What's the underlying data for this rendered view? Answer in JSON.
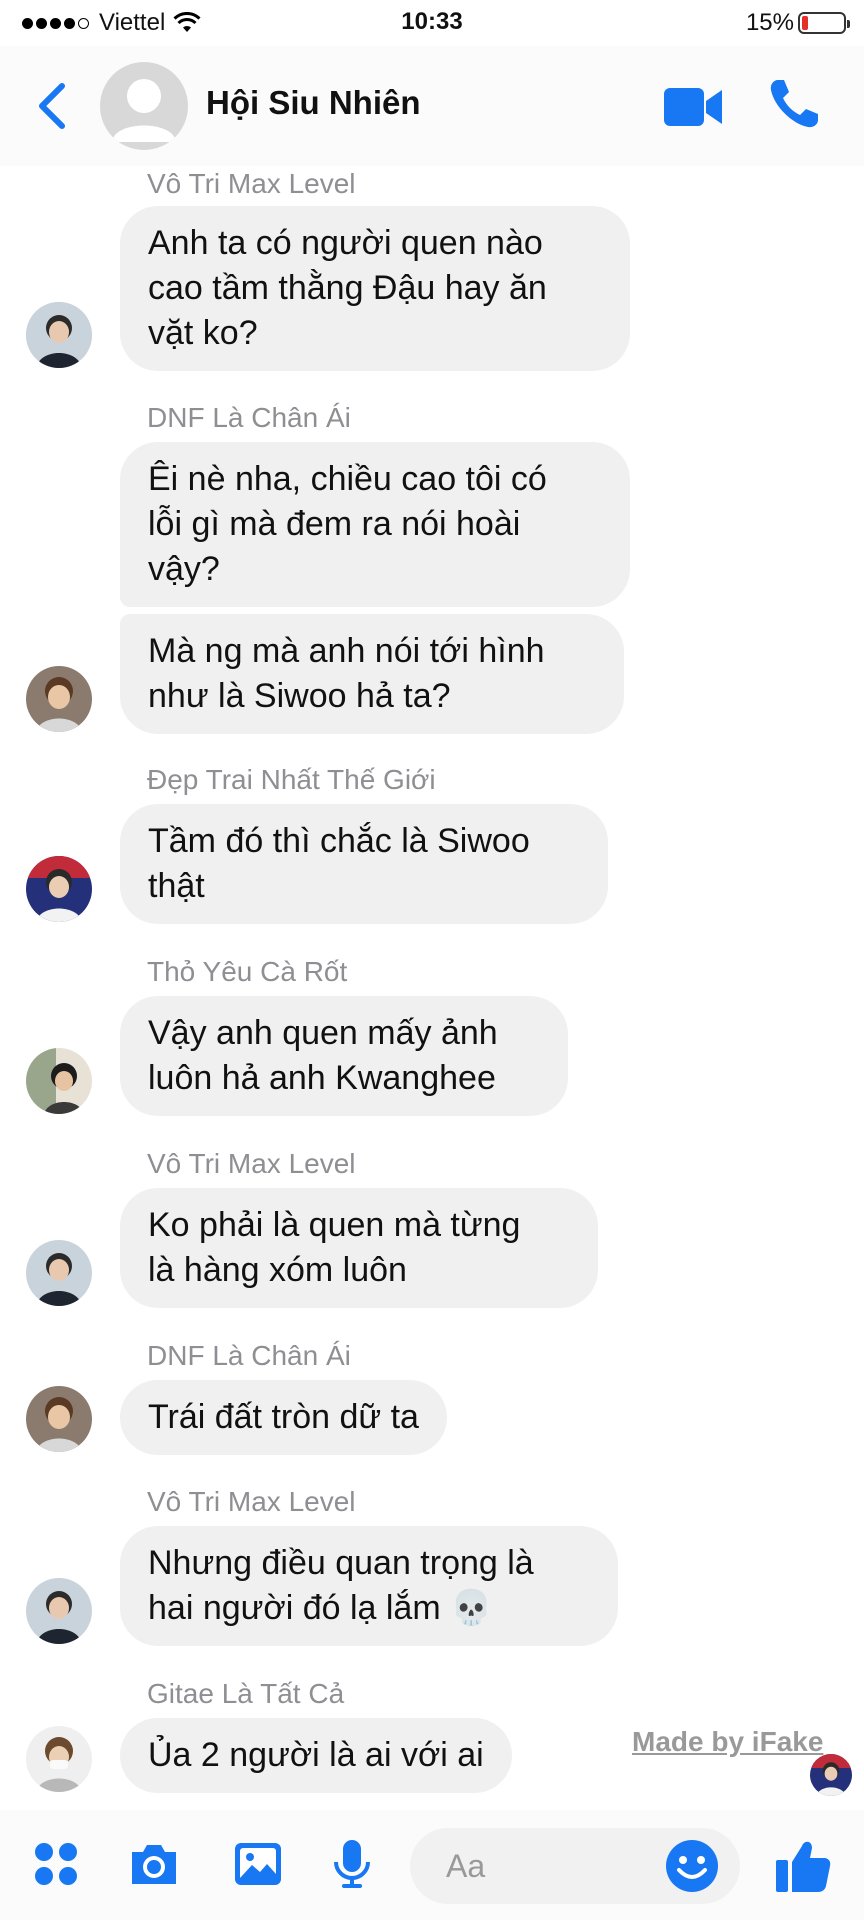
{
  "status_bar": {
    "carrier": "Viettel",
    "time": "10:33",
    "battery_percent": "15%",
    "battery_level": 0.15,
    "signal_bars": 4
  },
  "header": {
    "title": "Hội Siu Nhiên",
    "icons": [
      "back-chevron",
      "video-camera",
      "phone"
    ],
    "accent_color": "#1877f2"
  },
  "messages": [
    {
      "sender": "Vô Tri Max Level",
      "lines": [
        "Anh ta có người quen nào",
        "cao tầm thằng Đậu hay ăn",
        "vặt ko?"
      ]
    },
    {
      "sender": "DNF Là Chân Ái",
      "lines": [
        "Êi nè nha, chiều cao tôi có",
        "lỗi gì mà đem ra nói hoài",
        "vậy?"
      ]
    },
    {
      "sender": "",
      "lines": [
        "Mà ng mà anh nói tới hình",
        "như là Siwoo hả ta?"
      ]
    },
    {
      "sender": "Đẹp Trai Nhất Thế Giới",
      "lines": [
        "Tầm đó thì chắc là Siwoo",
        "thật"
      ]
    },
    {
      "sender": "Thỏ Yêu Cà Rốt",
      "lines": [
        "Vậy anh quen mấy ảnh",
        "luôn hả anh Kwanghee"
      ]
    },
    {
      "sender": "Vô Tri Max Level",
      "lines": [
        "Ko phải là quen mà từng",
        "là hàng xóm luôn"
      ]
    },
    {
      "sender": "DNF Là Chân Ái",
      "lines": [
        "Trái đất tròn dữ ta"
      ]
    },
    {
      "sender": "Vô Tri Max Level",
      "lines": [
        "Nhưng điều quan trọng là",
        "hai người đó lạ lắm 💀"
      ]
    },
    {
      "sender": "Gitae Là Tất Cả",
      "lines": [
        "Ủa 2 người là ai với ai"
      ]
    }
  ],
  "watermark": "Made by iFake",
  "bottom_bar": {
    "input_placeholder": "Aa",
    "icons": [
      "apps-grid",
      "camera",
      "image",
      "microphone",
      "emoji",
      "thumbs-up"
    ]
  }
}
